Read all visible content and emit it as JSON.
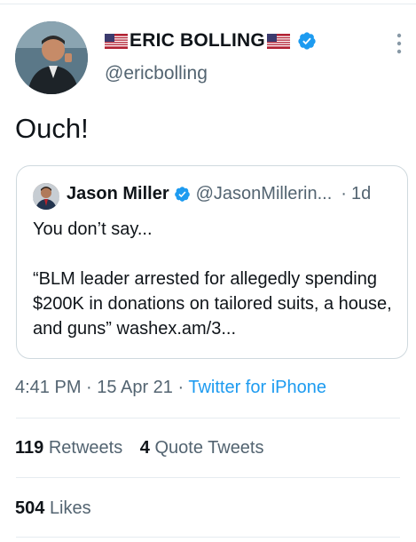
{
  "tweet": {
    "author": {
      "display_name": "ERIC BOLLING",
      "handle": "@ericbolling",
      "verified": true,
      "avatar_icon": "user-avatar"
    },
    "text": "Ouch!",
    "quoted": {
      "author_name": "Jason Miller",
      "author_handle": "@JasonMillerin...",
      "separator": "·",
      "time": "1d",
      "line1": "You don’t say...",
      "line2": "“BLM leader arrested for allegedly spending $200K in donations on tailored suits, a house, and guns”  washex.am/3..."
    },
    "meta": {
      "time": "4:41 PM",
      "sep1": "·",
      "date": "15 Apr 21",
      "sep2": "·",
      "source": "Twitter for iPhone"
    },
    "stats": {
      "retweets_count": "119",
      "retweets_label": "Retweets",
      "quotes_count": "4",
      "quotes_label": "Quote Tweets",
      "likes_count": "504",
      "likes_label": "Likes"
    }
  },
  "colors": {
    "accent": "#1d9bf0",
    "secondary_text": "#536471",
    "divider": "#e6ecf0"
  }
}
